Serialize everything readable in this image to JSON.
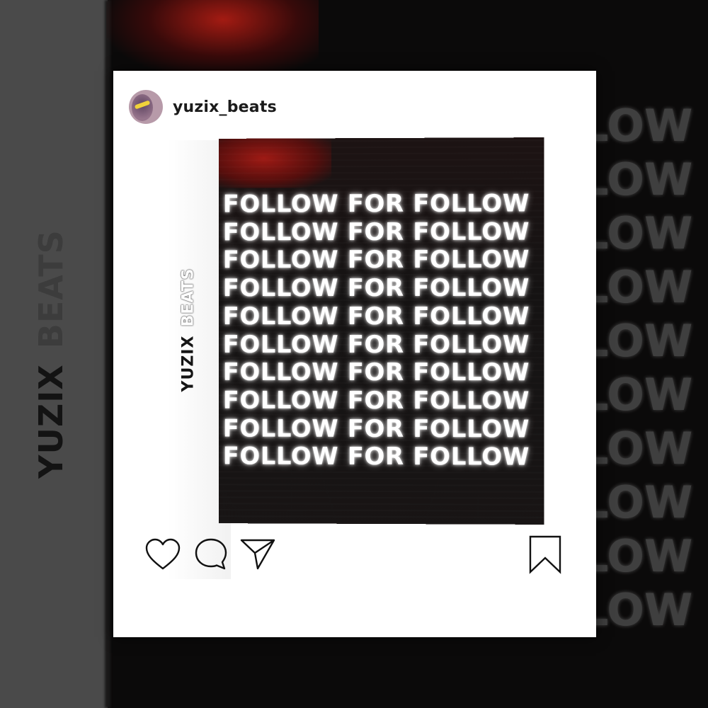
{
  "post": {
    "username": "yuzix_beats",
    "brand_first": "YUZIX",
    "brand_second": "BEATS",
    "follow_lines": [
      "FOLLOW FOR FOLLOW",
      "FOLLOW FOR FOLLOW",
      "FOLLOW FOR FOLLOW",
      "FOLLOW FOR FOLLOW",
      "FOLLOW FOR FOLLOW",
      "FOLLOW FOR FOLLOW",
      "FOLLOW FOR FOLLOW",
      "FOLLOW FOR FOLLOW",
      "FOLLOW FOR FOLLOW",
      "FOLLOW FOR FOLLOW"
    ]
  },
  "background": {
    "brand_first": "YUZIX",
    "brand_second": "BEATS",
    "text_rows": [
      "LOW",
      "LOW",
      "LOW",
      "LOW",
      "LOW",
      "LOW",
      "LOW",
      "LOW",
      "LOW",
      "LOW"
    ]
  },
  "actions": {
    "icons": [
      "heart-icon",
      "comment-icon",
      "share-icon",
      "bookmark-icon"
    ]
  },
  "colors": {
    "card": "#ffffff",
    "background": "#0b0a0a",
    "left_panel": "#4a4a4a",
    "accent_red": "#b31b14"
  }
}
